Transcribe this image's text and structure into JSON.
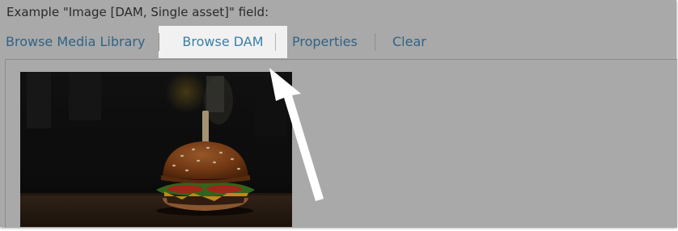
{
  "field": {
    "label": "Example \"Image [DAM, Single asset]\" field:"
  },
  "toolbar": {
    "browse_media_library": "Browse Media Library",
    "browse_dam": "Browse DAM",
    "properties": "Properties",
    "clear": "Clear"
  },
  "preview": {
    "image_subject": "burger-photo",
    "annotation": "white-arrow-pointing-to-browse-dam"
  },
  "colors": {
    "overlay_gray": "#a9a9a9",
    "link_blue": "#2f6384",
    "highlight_bg": "#f1f1f1",
    "highlight_link": "#3a7fa6"
  }
}
